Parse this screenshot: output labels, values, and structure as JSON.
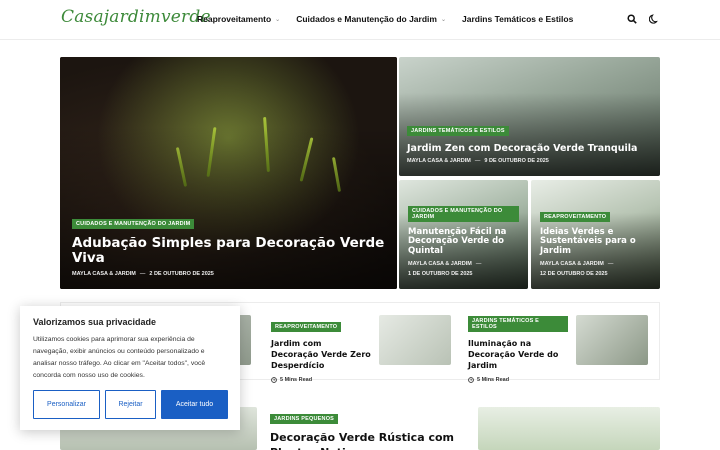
{
  "site": {
    "logo": "Casajardimverde"
  },
  "nav": [
    {
      "label": "Reaproveitamento",
      "dropdown": true
    },
    {
      "label": "Cuidados e Manutenção do Jardim",
      "dropdown": true
    },
    {
      "label": "Jardins Temáticos e Estilos",
      "dropdown": false
    }
  ],
  "header_icons": [
    "search-icon",
    "moon-icon"
  ],
  "hero": {
    "main": {
      "category": "Cuidados e Manutenção do Jardim",
      "title": "Adubação Simples para Decoração Verde Viva",
      "author": "Mayla Casa & Jardim",
      "date": "2 de outubro de 2025"
    },
    "top_right": {
      "category": "Jardins Temáticos e Estilos",
      "title": "Jardim Zen com Decoração Verde Tranquila",
      "author": "Mayla Casa & Jardim",
      "date": "9 de outubro de 2025"
    },
    "bottom_left": {
      "category": "Cuidados e Manutenção do Jardim",
      "title": "Manutenção Fácil na Decoração Verde do Quintal",
      "author": "Mayla Casa & Jardim",
      "date": "1 de outubro de 2025"
    },
    "bottom_right": {
      "category": "Reaproveitamento",
      "title": "Ideias Verdes e Sustentáveis para o Jardim",
      "author": "Mayla Casa & Jardim",
      "date": "12 de outubro de 2025"
    }
  },
  "row2": [
    {
      "category": "Reaproveitamento",
      "title": "Jardim com Decoração Verde Zero Desperdício",
      "read": "5 Mins Read"
    },
    {
      "category": "Jardins Temáticos e Estilos",
      "title": "Iluminação na Decoração Verde do Jardim",
      "read": "5 Mins Read"
    }
  ],
  "bottom": {
    "category": "Jardins Pequenos",
    "title": "Decoração Verde Rústica com Plantas Nati..."
  },
  "cookie": {
    "title": "Valorizamos sua privacidade",
    "text": "Utilizamos cookies para aprimorar sua experiência de navegação, exibir anúncios ou conteúdo personalizado e analisar nosso tráfego. Ao clicar em \"Aceitar todos\", você concorda com nosso uso de cookies.",
    "customize": "Personalizar",
    "reject": "Rejeitar",
    "accept": "Aceitar tudo"
  },
  "colors": {
    "accent": "#3c8b39",
    "button": "#1a5fc4"
  }
}
